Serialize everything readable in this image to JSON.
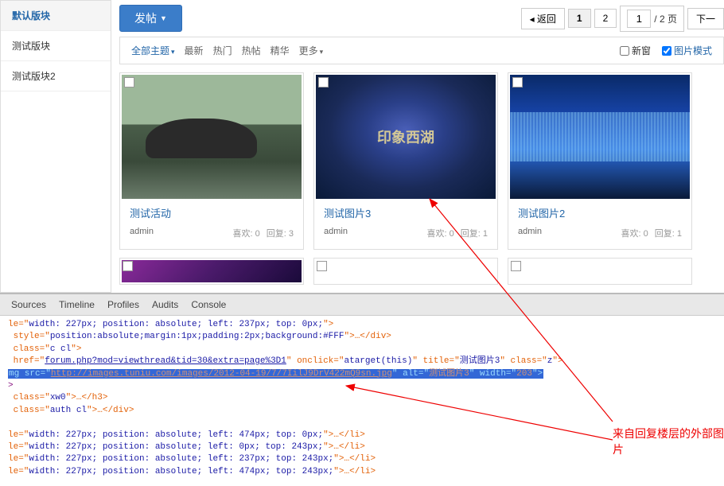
{
  "sidebar": {
    "items": [
      {
        "label": "默认版块",
        "active": true
      },
      {
        "label": "测试版块",
        "active": false
      },
      {
        "label": "测试版块2",
        "active": false
      }
    ]
  },
  "topbar": {
    "post_label": "发帖"
  },
  "pagination": {
    "back_label": "◂ 返回",
    "page1": "1",
    "page2": "2",
    "input_value": "1",
    "total_label": "/ 2 页",
    "next_label": "下一"
  },
  "filters": {
    "all": "全部主题",
    "latest": "最新",
    "popular": "热门",
    "hot": "热帖",
    "digest": "精华",
    "more": "更多",
    "new_window": "新窗",
    "pic_mode": "图片模式"
  },
  "cards": [
    {
      "title": "测试活动",
      "author": "admin",
      "likes_label": "喜欢:",
      "likes": "0",
      "replies_label": "回复:",
      "replies": "3"
    },
    {
      "title": "测试图片3",
      "author": "admin",
      "likes_label": "喜欢:",
      "likes": "0",
      "replies_label": "回复:",
      "replies": "1"
    },
    {
      "title": "测试图片2",
      "author": "admin",
      "likes_label": "喜欢:",
      "likes": "0",
      "replies_label": "回复:",
      "replies": "1"
    }
  ],
  "devtools": {
    "tabs": [
      "Sources",
      "Timeline",
      "Profiles",
      "Audits",
      "Console"
    ],
    "lines": {
      "l1a": "le=\"",
      "l1b": "width: 227px; position: absolute; left: 237px; top: 0px;",
      "l1c": "\">",
      "l2a": "style=\"",
      "l2b": "position:absolute;margin:1px;padding:2px;background:#FFF",
      "l2c": "\">…</div>",
      "l3a": "class=\"",
      "l3b": "c cl",
      "l3c": "\">",
      "l4a": "href=\"",
      "l4b": "forum.php?mod=viewthread&tid=30&extra=page%3D1",
      "l4c": "\" onclick=\"",
      "l4d": "atarget(this)",
      "l4e": "\" title=\"",
      "l4f": "测试图片3",
      "l4g": "\" class=\"",
      "l4h": "z",
      "l4i": "\">",
      "l5a": "mg src=\"",
      "l5b": "http://images.tuniu.com/images/2012-04-19/7/7IilJ9DrV422mQ9sn.jpg",
      "l5c": "\" alt=\"",
      "l5d": "测试图片3",
      "l5e": "\" width=\"",
      "l5f": "203",
      "l5g": "\">",
      "l6": ">",
      "l7a": "class=\"",
      "l7b": "xw0",
      "l7c": "\">…</h3>",
      "l8a": "class=\"",
      "l8b": "auth cl",
      "l8c": "\">…</div>",
      "l9a": "le=\"",
      "l9b": "width: 227px; position: absolute; left: 474px; top: 0px;",
      "l9c": "\">…</li>",
      "l10a": "le=\"",
      "l10b": "width: 227px; position: absolute; left: 0px; top: 243px;",
      "l10c": "\">…</li>",
      "l11a": "le=\"",
      "l11b": "width: 227px; position: absolute; left: 237px; top: 243px;",
      "l11c": "\">…</li>",
      "l12a": "le=\"",
      "l12b": "width: 227px; position: absolute; left: 474px; top: 243px;",
      "l12c": "\">…</li>"
    }
  },
  "annotation": {
    "text": "来自回复楼层的外部图片"
  },
  "img2_text": "印象西湖"
}
